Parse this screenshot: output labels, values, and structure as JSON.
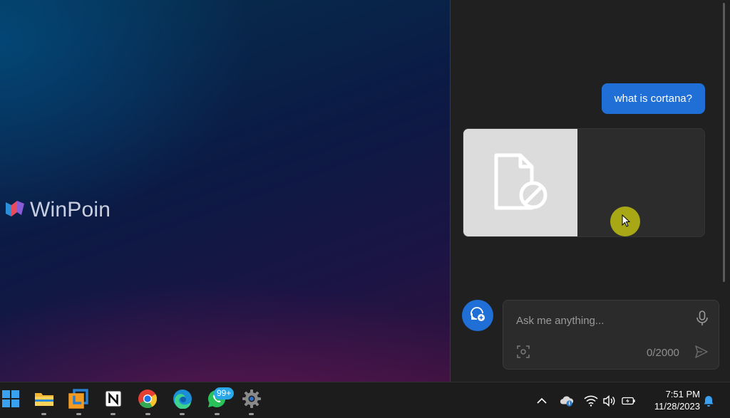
{
  "desktop": {
    "watermark": {
      "text": "WinPoin",
      "icon": "winpoin-logo-icon"
    }
  },
  "copilot": {
    "messages": [
      {
        "role": "user",
        "text": "what is cortana?"
      }
    ],
    "result_card": {
      "thumbnail_icon": "broken-file-icon"
    },
    "composer": {
      "new_topic_icon": "new-topic-icon",
      "placeholder": "Ask me anything...",
      "value": "",
      "char_count": "0/2000",
      "mic_icon": "microphone-icon",
      "image_icon": "image-capture-icon",
      "send_icon": "send-icon"
    },
    "accent_color": "#1f6fd6"
  },
  "taskbar": {
    "pinned_apps": [
      {
        "name": "start-button",
        "icon": "windows-icon"
      },
      {
        "name": "file-explorer",
        "icon": "folder-icon"
      },
      {
        "name": "vmware",
        "icon": "vmware-icon"
      },
      {
        "name": "notion",
        "icon": "notion-icon"
      },
      {
        "name": "chrome",
        "icon": "chrome-icon"
      },
      {
        "name": "edge",
        "icon": "edge-icon"
      },
      {
        "name": "whatsapp",
        "icon": "whatsapp-icon",
        "badge": "99+"
      },
      {
        "name": "settings",
        "icon": "gear-icon"
      }
    ],
    "tray": {
      "icons": [
        "chevron-up-icon",
        "onedrive-icon",
        "wifi-icon",
        "volume-icon",
        "battery-icon",
        "notification-bell-icon"
      ],
      "time": "7:51 PM",
      "date": "11/28/2023"
    }
  }
}
